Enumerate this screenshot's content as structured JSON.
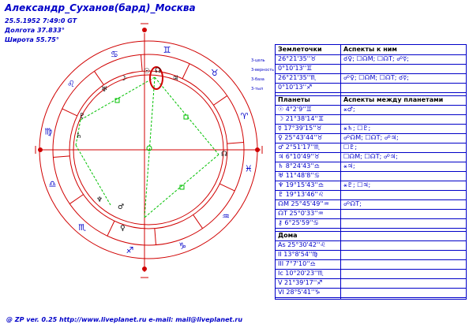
{
  "header": {
    "title": "Александр_Суханов(бард)_Москва",
    "datetime": "25.5.1952 7:49:0 GT",
    "longitude": "Долгота 37.833°",
    "latitude": "Широта 55.75°"
  },
  "chart": {
    "zodiac_signs": [
      "♈",
      "♉",
      "♊",
      "♋",
      "♌",
      "♍",
      "♎",
      "♏",
      "♐",
      "♑",
      "♒",
      "♓"
    ],
    "planet_glyphs": [
      "☉",
      "☽",
      "☿",
      "♀",
      "♂",
      "♃",
      "♄",
      "♅",
      "♆",
      "♇",
      "☊"
    ],
    "side_labels": [
      "3-цель",
      "3-верность",
      "3-база",
      "3-тыл"
    ],
    "ring_colors": {
      "outer": "#d00000",
      "inner": "#d00000",
      "aspect": "#00c000",
      "highlight": "#d00000"
    }
  },
  "panel": {
    "zemletochki_header": "Землеточки",
    "zemletochki_aspects_header": "Аспекты к ним",
    "zemletochki": [
      {
        "left": "26°21'35''♉",
        "right": "☌♀; ☐☊M; ☐☊T; ☍☿;"
      },
      {
        "left": "0°10'13''♊",
        "right": ""
      },
      {
        "left": "26°21'35''♏",
        "right": "☍♀; ☐☊M; ☐☊T; ☌☿;"
      },
      {
        "left": "0°10'13''♐",
        "right": ""
      }
    ],
    "planets_header": "Планеты",
    "planets_aspects_header": "Аспекты между планетами",
    "planets": [
      {
        "left": "☉ 4°2'9''♊",
        "right": "⚹♂;"
      },
      {
        "left": "☽ 21°38'14''♊",
        "right": ""
      },
      {
        "left": "☿ 17°39'15''♉",
        "right": "⚹♄; ☐♇;"
      },
      {
        "left": "♀ 25°43'44''♉",
        "right": "☍☊M; ☐☊T; ☍♃;"
      },
      {
        "left": "♂ 2°51'17''♏",
        "right": "☐♇;"
      },
      {
        "left": "♃ 6°10'49''♉",
        "right": "☐☊M; ☐☊T; ☍♃;"
      },
      {
        "left": "♄ 8°24'43''♎",
        "right": "⚹♃;"
      },
      {
        "left": "♅ 11°48'8''♋",
        "right": ""
      },
      {
        "left": "♆ 19°15'43''♎",
        "right": "⚹♇; ☐♃;"
      },
      {
        "left": "♇ 19°13'46''♌",
        "right": ""
      },
      {
        "left": "☊M 25°45'49''♒",
        "right": "☍☊T;"
      },
      {
        "left": "☊T 25°0'33''♒",
        "right": ""
      },
      {
        "left": "⚷ 6°25'59''♋",
        "right": ""
      }
    ],
    "houses_header": "Дома",
    "houses": [
      {
        "left": "As 25°30'42''♌",
        "right": ""
      },
      {
        "left": "II 13°8'54''♍",
        "right": ""
      },
      {
        "left": "III 7°7'10''♎",
        "right": ""
      },
      {
        "left": "Ic 10°20'23''♏",
        "right": ""
      },
      {
        "left": "V 21°39'17''♐",
        "right": ""
      },
      {
        "left": "VI 28°5'41''♑",
        "right": ""
      }
    ]
  },
  "footer": "@ ZP  ver. 0.25 http://www.liveplanet.ru  e-mail: mail@liveplanet.ru"
}
